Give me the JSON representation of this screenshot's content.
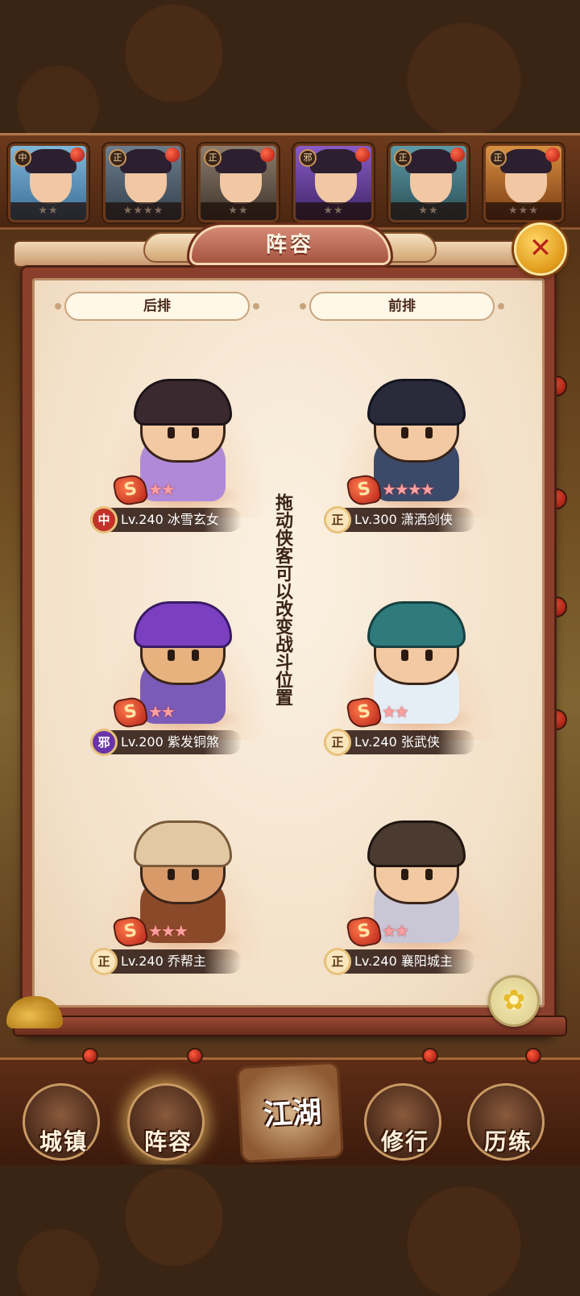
{
  "panel": {
    "title": "阵容",
    "close_icon": "close-icon",
    "back_row_label": "后排",
    "front_row_label": "前排",
    "hint": "拖动侠客可以改变战斗位置"
  },
  "strip": [
    {
      "align": "中",
      "stars": "★★"
    },
    {
      "align": "正",
      "stars": "★★★★"
    },
    {
      "align": "正",
      "stars": "★★"
    },
    {
      "align": "邪",
      "stars": "★★"
    },
    {
      "align": "正",
      "stars": "★★"
    },
    {
      "align": "正",
      "stars": "★★★"
    }
  ],
  "heroes": {
    "back": [
      {
        "align": "中",
        "level": "Lv.240",
        "name": "冰雪玄女",
        "stars": "★★",
        "grade": "S"
      },
      {
        "align": "邪",
        "level": "Lv.200",
        "name": "紫发铜煞",
        "stars": "★★",
        "grade": "S"
      },
      {
        "align": "正",
        "level": "Lv.240",
        "name": "乔帮主",
        "stars": "★★★",
        "grade": "S"
      }
    ],
    "front": [
      {
        "align": "正",
        "level": "Lv.300",
        "name": "潇洒剑侠",
        "stars": "★★★★",
        "grade": "S"
      },
      {
        "align": "正",
        "level": "Lv.240",
        "name": "张武侠",
        "stars": "★★",
        "grade": "S"
      },
      {
        "align": "正",
        "level": "Lv.240",
        "name": "襄阳城主",
        "stars": "★★",
        "grade": "S"
      }
    ]
  },
  "nav": {
    "town": "城镇",
    "lineup": "阵容",
    "jianghu": "江湖",
    "training": "修行",
    "experience": "历练"
  },
  "colors": {
    "panel_frame": "#8a3f2c",
    "panel_bg": "#f3e1c9",
    "close_button": "#e09a1a",
    "star": "#ff9fa0"
  }
}
